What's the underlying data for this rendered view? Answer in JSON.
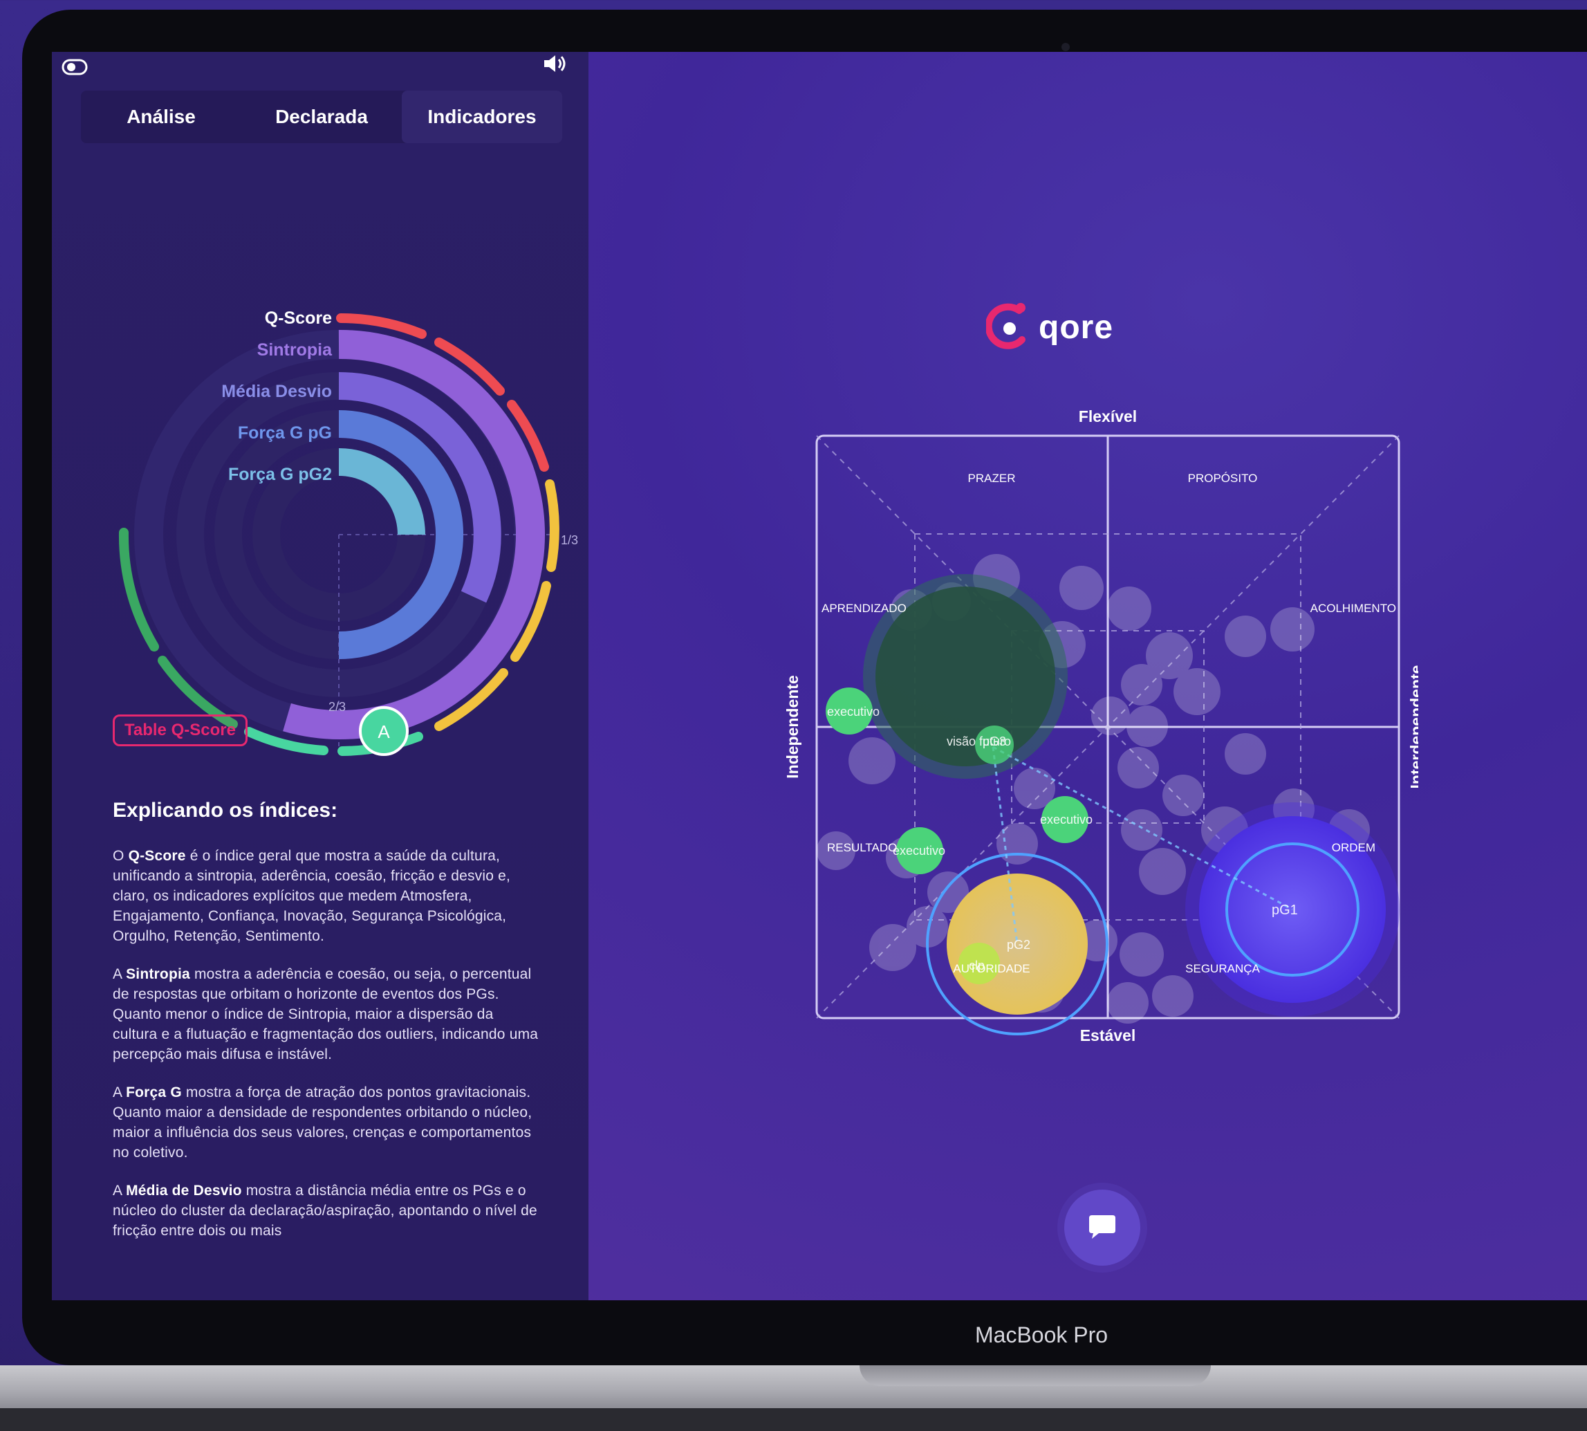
{
  "toolbar": {
    "toggle_icon": "toggle-icon",
    "speaker_icon": "speaker-icon"
  },
  "tabs": [
    {
      "label": "Análise",
      "active": false
    },
    {
      "label": "Declarada",
      "active": false
    },
    {
      "label": "Indicadores",
      "active": true
    }
  ],
  "radial": {
    "labels": [
      {
        "text": "Q-Score",
        "color": "#ffffff"
      },
      {
        "text": "Sintropia",
        "color": "#a07ae6"
      },
      {
        "text": "Média Desvio",
        "color": "#8a8ee8"
      },
      {
        "text": "Força G pG",
        "color": "#6f96ec"
      },
      {
        "text": "Força G pG2",
        "color": "#7cc0e8"
      }
    ],
    "tick_1_3": "1/3",
    "tick_2_3": "2/3",
    "marker": "A"
  },
  "table_button": "Table Q-Score",
  "explain": {
    "title": "Explicando os índices:",
    "paragraphs": [
      {
        "bold": "Q-Score",
        "pre": "O ",
        "post": " é o índice geral que mostra a saúde da cultura, unificando a sintropia, aderência, coesão, fricção e desvio e, claro, os indicadores explícitos que medem Atmosfera, Engajamento, Confiança, Inovação, Segurança Psicológica, Orgulho, Retenção, Sentimento."
      },
      {
        "bold": "Sintropia",
        "pre": "A ",
        "post": " mostra a aderência e coesão, ou seja, o percentual de respostas que orbitam o horizonte de eventos dos PGs. Quanto menor o índice de Sintropia, maior a dispersão da cultura e a flutuação e fragmentação dos outliers, indicando uma percepção mais difusa e instável."
      },
      {
        "bold": "Força G",
        "pre": "A ",
        "post": " mostra a força de atração dos pontos gravitacionais. Quanto maior a densidade de respondentes orbitando o núcleo, maior a influência dos seus valores, crenças e comportamentos no coletivo."
      },
      {
        "bold": "Média de Desvio",
        "pre": "A ",
        "post": " mostra a distância média entre os PGs e o núcleo do cluster da declaração/aspiração, apontando o nível de fricção entre dois ou mais"
      }
    ]
  },
  "logo": {
    "text": "qore"
  },
  "matrix": {
    "top": "Flexível",
    "bottom": "Estável",
    "left": "Independente",
    "right": "Interdependente",
    "quadrants": [
      "PRAZER",
      "PROPÓSITO",
      "APRENDIZADO",
      "ACOLHIMENTO",
      "RESULTADO",
      "ORDEM",
      "AUTORIDADE",
      "SEGURANÇA"
    ],
    "points": [
      "executivo",
      "visão futuro",
      "pG3",
      "executivo",
      "executivo",
      "pG2",
      "pG1",
      "clp"
    ]
  },
  "chat_icon": "chat-icon",
  "device_label": "MacBook Pro",
  "colors": {
    "accent": "#e8286f",
    "panel": "#2b1f66",
    "green": "#4bd37a",
    "yellow": "#e8c65a",
    "blue": "#5b3ff0"
  }
}
